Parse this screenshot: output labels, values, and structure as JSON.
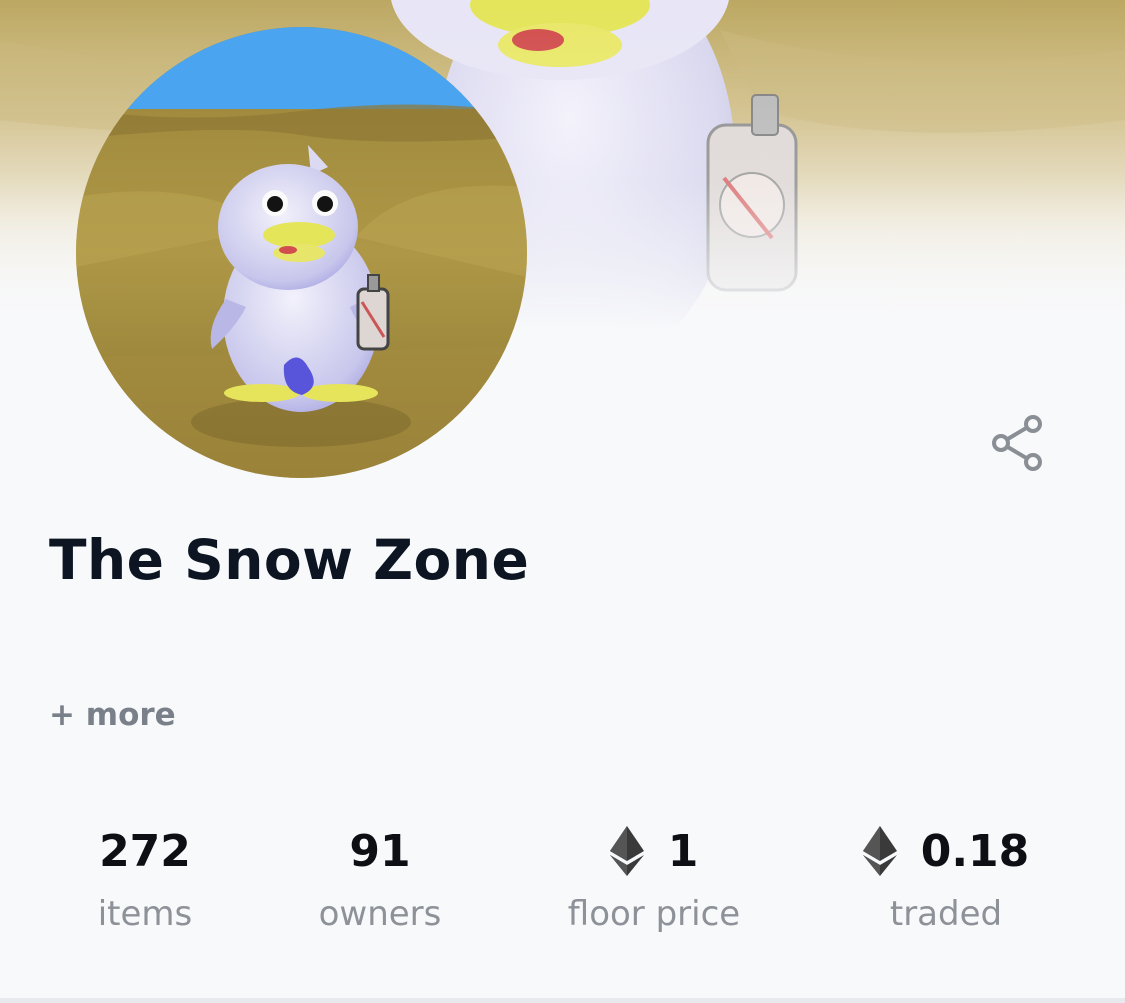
{
  "collection": {
    "title": "The Snow Zone",
    "more_label": "+ more"
  },
  "stats": [
    {
      "value": "272",
      "label": "items",
      "icon": null
    },
    {
      "value": "91",
      "label": "owners",
      "icon": null
    },
    {
      "value": "1",
      "label": "floor price",
      "icon": "ethereum-icon"
    },
    {
      "value": "0.18",
      "label": "traded",
      "icon": "ethereum-icon"
    }
  ],
  "icons": {
    "share": "share-icon",
    "currency": "ethereum-icon"
  },
  "colors": {
    "title": "#0d1522",
    "muted": "#8d9198",
    "more": "#7a8089",
    "sky": "#4aa4ef",
    "sand": "#a89244"
  }
}
